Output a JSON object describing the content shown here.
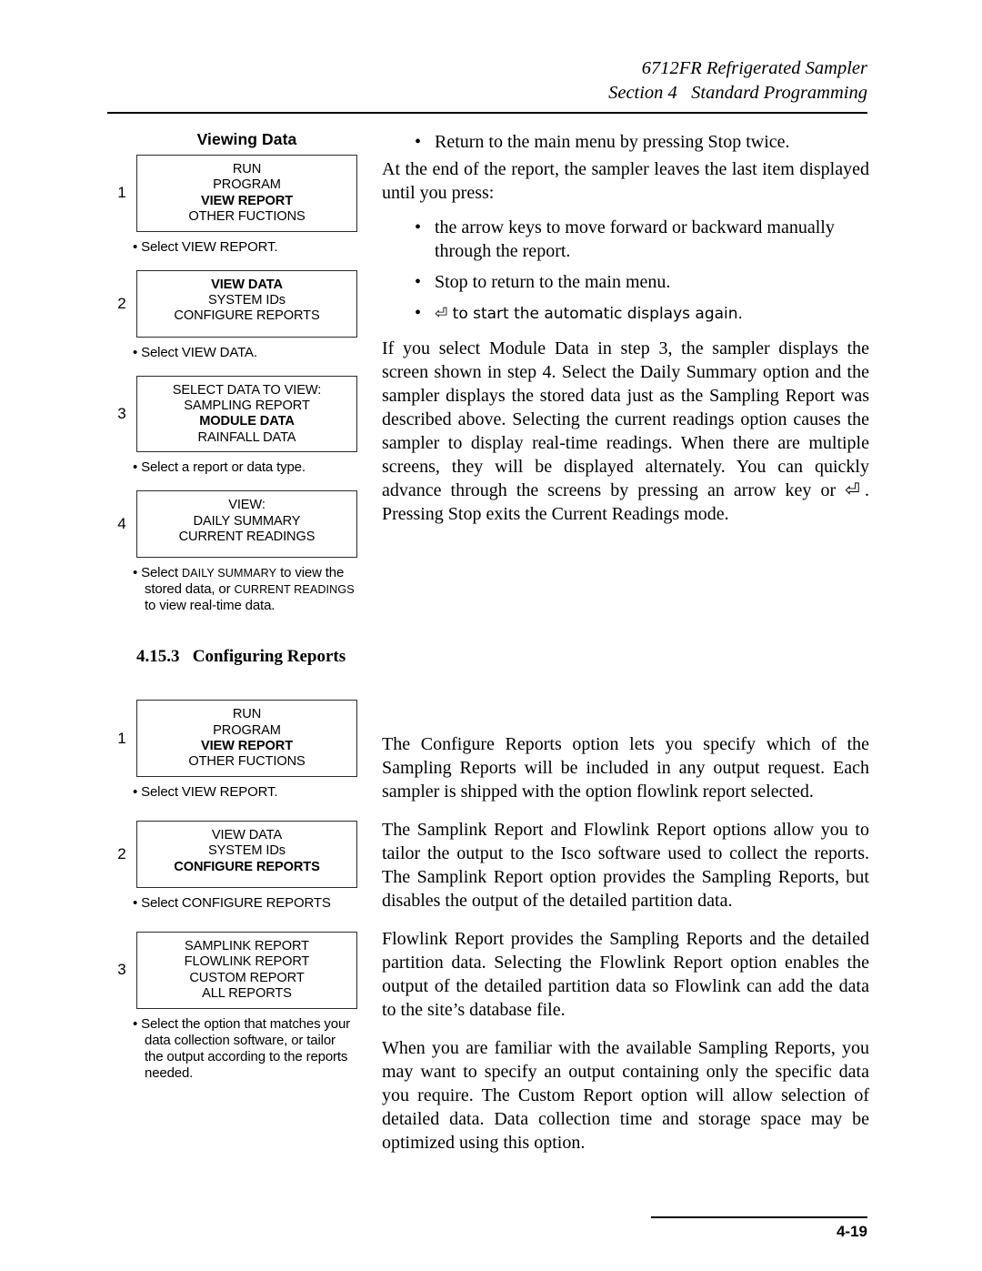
{
  "header": {
    "line1": "6712FR Refrigerated Sampler",
    "line2": "Section 4   Standard Programming"
  },
  "footer": {
    "page_number": "4-19"
  },
  "left_column": {
    "group1": {
      "title": "Viewing Data",
      "steps": [
        {
          "number": "1",
          "lines": [
            {
              "text": "RUN",
              "bold": false
            },
            {
              "text": "PROGRAM",
              "bold": false
            },
            {
              "text": "VIEW REPORT",
              "bold": true
            },
            {
              "text": "OTHER FUCTIONS",
              "bold": false
            }
          ],
          "caption": "Select VIEW REPORT."
        },
        {
          "number": "2",
          "lines": [
            {
              "text": "VIEW DATA",
              "bold": true
            },
            {
              "text": "SYSTEM IDs",
              "bold": false
            },
            {
              "text": "CONFIGURE REPORTS",
              "bold": false
            }
          ],
          "caption": "Select VIEW DATA."
        },
        {
          "number": "3",
          "lines": [
            {
              "text": "SELECT DATA TO VIEW:",
              "bold": false
            },
            {
              "text": "SAMPLING REPORT",
              "bold": false
            },
            {
              "text": "MODULE DATA",
              "bold": true
            },
            {
              "text": "RAINFALL DATA",
              "bold": false
            }
          ],
          "caption": "Select a report or data type."
        },
        {
          "number": "4",
          "lines": [
            {
              "text": "VIEW:",
              "bold": false
            },
            {
              "text": "DAILY SUMMARY",
              "bold": false
            },
            {
              "text": "CURRENT READINGS",
              "bold": false
            }
          ],
          "caption_parts": [
            {
              "text": "Select ",
              "smallcaps": false
            },
            {
              "text": "DAILY SUMMARY",
              "smallcaps": true
            },
            {
              "text": " to view the stored data, or ",
              "smallcaps": false
            },
            {
              "text": "CURRENT READINGS",
              "smallcaps": true
            },
            {
              "text": " to view real-time data.",
              "smallcaps": false
            }
          ]
        }
      ]
    },
    "section_heading": "4.15.3   Configuring Reports",
    "group2": {
      "steps": [
        {
          "number": "1",
          "lines": [
            {
              "text": "RUN",
              "bold": false
            },
            {
              "text": "PROGRAM",
              "bold": false
            },
            {
              "text": "VIEW REPORT",
              "bold": true
            },
            {
              "text": "OTHER FUCTIONS",
              "bold": false
            }
          ],
          "caption": "Select VIEW REPORT."
        },
        {
          "number": "2",
          "lines": [
            {
              "text": "VIEW DATA",
              "bold": false
            },
            {
              "text": "SYSTEM IDs",
              "bold": false
            },
            {
              "text": "CONFIGURE REPORTS",
              "bold": true
            }
          ],
          "caption": "Select CONFIGURE REPORTS"
        },
        {
          "number": "3",
          "lines": [
            {
              "text": "SAMPLINK REPORT",
              "bold": false
            },
            {
              "text": "FLOWLINK REPORT",
              "bold": false
            },
            {
              "text": "CUSTOM REPORT",
              "bold": false
            },
            {
              "text": "ALL REPORTS",
              "bold": false
            }
          ],
          "caption": "Select the option that matches your data collection software, or tailor the output according to the reports needed."
        }
      ]
    }
  },
  "right_column": {
    "bullet_top": "Return to the main menu by pressing Stop twice.",
    "paragraph_intro": "At the end of the report, the sampler leaves the last item displayed until you press:",
    "bullets": [
      "the arrow keys to move forward or backward manually through the report.",
      "Stop to return to the main menu.",
      "⏎ to start the automatic displays again."
    ],
    "paragraph_module": "If you select Module Data in step 3, the sampler displays the screen shown in step 4. Select the Daily Summary option and the sampler displays the stored data just as the Sampling Report was described above. Selecting the current readings option causes the sampler to display real-time readings. When there are multiple screens, they will be displayed alternately. You can quickly advance through the screens by pressing an arrow key or ⏎. Pressing Stop exits the Current Readings mode.",
    "paragraph_configure": "The Configure Reports option lets you specify which of the Sampling Reports will be included in any output request. Each sampler is shipped with the option flowlink report selected.",
    "paragraph_samplink": "The Samplink Report and Flowlink Report options allow you to tailor the output to the Isco software used to collect the reports. The Samplink Report option provides the Sampling Reports, but disables the output of the detailed partition data.",
    "paragraph_flowlink": "Flowlink Report provides the Sampling Reports and the detailed partition data. Selecting the Flowlink Report option enables the output of the detailed partition data so Flowlink can add the data to the site’s database file.",
    "paragraph_custom": "When you are familiar with the available Sampling Reports, you may want to specify an output containing only the specific data you require. The Custom Report option will allow selection of detailed data. Data collection time and storage space may be optimized using this option."
  }
}
